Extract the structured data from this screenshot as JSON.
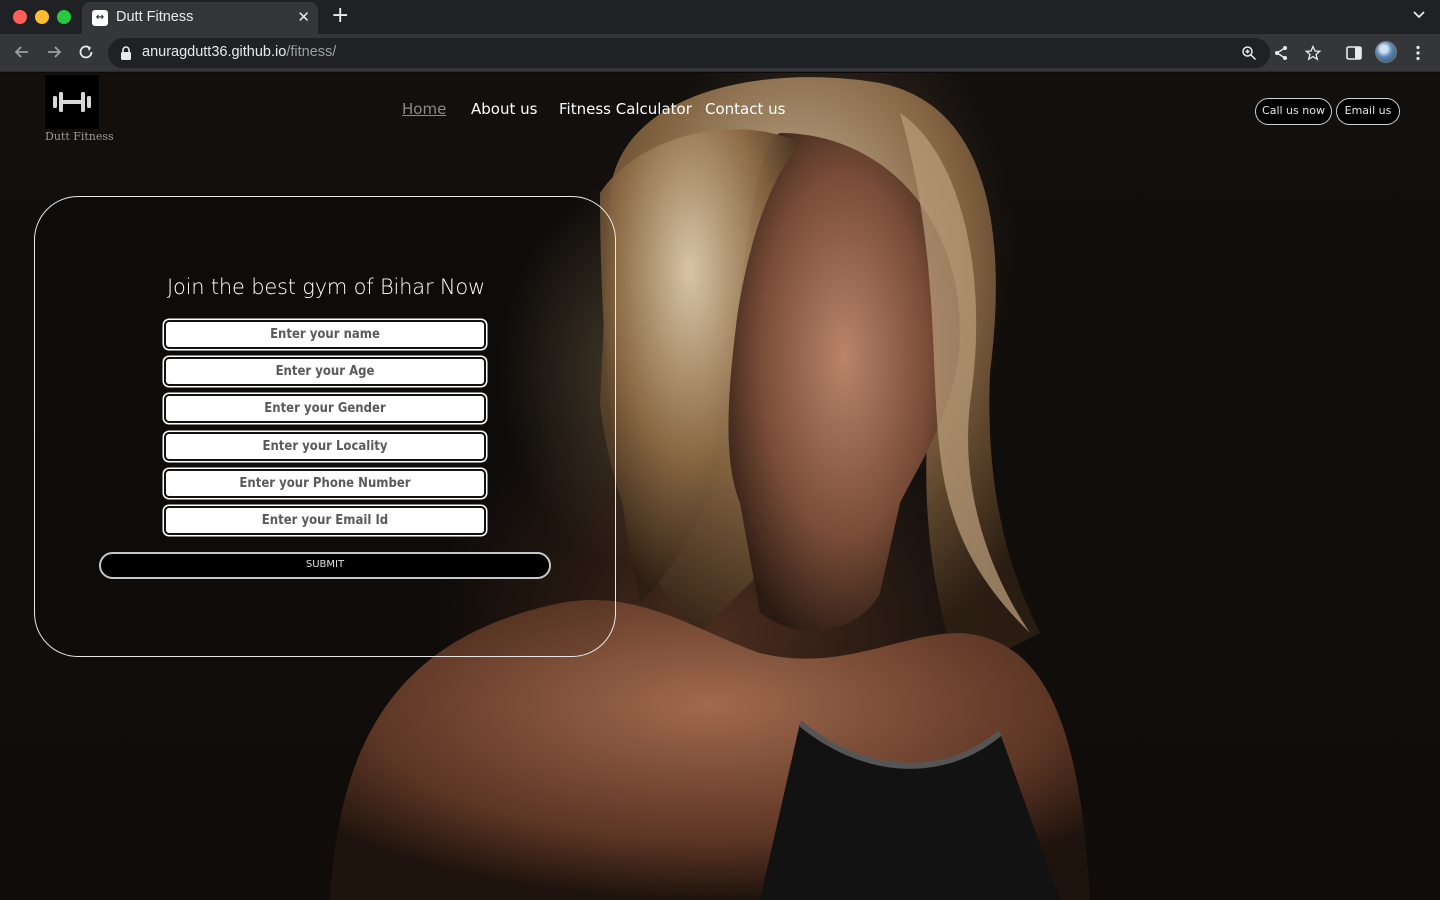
{
  "browser": {
    "tab_title": "Dutt Fitness",
    "tab_favicon": "↔",
    "url_host": "anuragdutt36.github.io",
    "url_path": "/fitness/"
  },
  "icons": {
    "back": "arrow-left-icon",
    "forward": "arrow-right-icon",
    "reload": "reload-icon",
    "lock": "lock-icon",
    "zoom": "zoom-icon",
    "share": "share-icon",
    "bookmark": "star-icon",
    "sidepanel": "side-panel-icon",
    "menu": "kebab-menu-icon",
    "logo": "dumbbell-icon"
  },
  "site": {
    "logo_text": "Dutt Fitness",
    "nav": {
      "home": "Home",
      "about": "About us",
      "calculator": "Fitness Calculator",
      "contact": "Contact us"
    },
    "call_button": "Call us now",
    "email_button": "Email us"
  },
  "form": {
    "title": "Join the best gym of Bihar Now",
    "fields": {
      "name": "Enter your name",
      "age": "Enter your Age",
      "gender": "Enter your Gender",
      "locality": "Enter your Locality",
      "phone": "Enter your Phone Number",
      "email": "Enter your Email Id"
    },
    "submit": "SUBMIT"
  },
  "colors": {
    "page_bg": "#0d0b0a",
    "chrome_dark": "#202124",
    "chrome_light": "#35363a"
  }
}
